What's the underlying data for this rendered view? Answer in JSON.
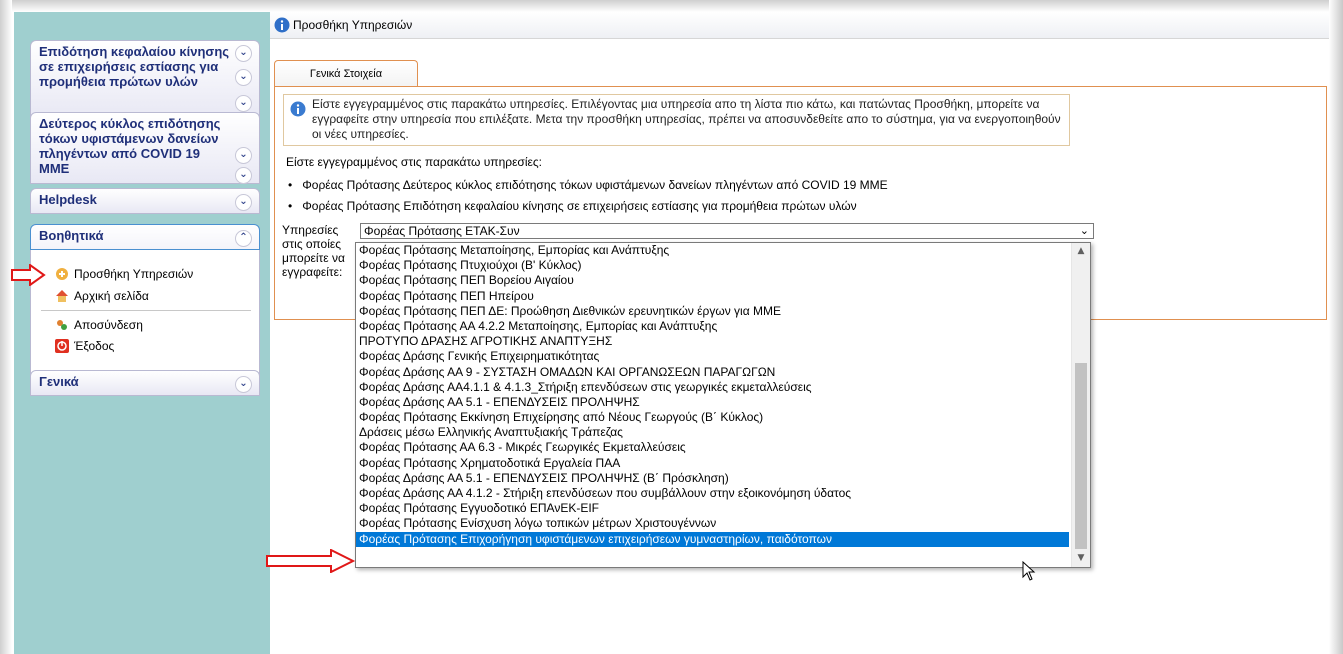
{
  "sidebar": {
    "panels": [
      {
        "title": "Επιδότηση κεφαλαίου κίνησης σε επιχειρήσεις εστίασης για προμήθεια πρώτων υλών"
      },
      {
        "title": "Δεύτερος κύκλος επιδότησης τόκων υφιστάμενων δανείων πληγέντων από COVID 19 ΜΜΕ"
      },
      {
        "title": "Helpdesk"
      },
      {
        "title": "Βοηθητικά"
      },
      {
        "title": "Γενικά"
      }
    ],
    "items": [
      {
        "label": "Προσθήκη Υπηρεσιών",
        "icon": "add-service-icon"
      },
      {
        "label": "Αρχική σελίδα",
        "icon": "home-icon"
      },
      {
        "label": "Αποσύνδεση",
        "icon": "logout-icon"
      },
      {
        "label": "Έξοδος",
        "icon": "exit-icon"
      }
    ]
  },
  "main": {
    "title": "Προσθήκη Υπηρεσιών",
    "tab": "Γενικά Στοιχεία",
    "notice": "Είστε εγγεγραμμένος στις παρακάτω υπηρεσίες. Επιλέγοντας μια υπηρεσία απο τη λίστα πιο κάτω, και πατώντας Προσθήκη, μπορείτε να εγγραφείτε στην υπηρεσία που επιλέξατε. Μετα την προσθήκη υπηρεσίας, πρέπει να αποσυνδεθείτε απο το σύστημα, για να ενεργοποιηθούν οι νέες υπηρεσίες.",
    "registered_title": "Είστε εγγεγραμμένος στις παρακάτω υπηρεσίες:",
    "registered": [
      "Φορέας Πρότασης Δεύτερος κύκλος επιδότησης τόκων υφιστάμενων δανείων πληγέντων από COVID 19 ΜΜΕ",
      "Φορέας Πρότασης Επιδότηση κεφαλαίου κίνησης σε επιχειρήσεις εστίασης για προμήθεια πρώτων υλών"
    ],
    "select_label": "Υπηρεσίες στις οποίες μπορείτε να εγγραφείτε:",
    "select_value": "Φορέας Πρότασης ΕΤΑΚ-Συν",
    "options": [
      "Φορέας Πρότασης Μεταποίησης, Εμπορίας και Ανάπτυξης",
      "Φορέας Πρότασης Πτυχιούχοι (Β' Κύκλος)",
      "Φορέας Πρότασης ΠΕΠ Βορείου Αιγαίου",
      "Φορέας Πρότασης ΠΕΠ Ηπείρου",
      "Φορέας Πρότασης ΠΕΠ ΔΕ: Προώθηση Διεθνικών ερευνητικών έργων για ΜΜΕ",
      "Φορέας Πρότασης ΑΑ 4.2.2 Μεταποίησης, Εμπορίας και Ανάπτυξης",
      "ΠΡΟΤΥΠΟ ΔΡΑΣΗΣ ΑΓΡΟΤΙΚΗΣ ΑΝΑΠΤΥΞΗΣ",
      "Φορέας Δράσης Γενικής Επιχειρηματικότητας",
      "Φορέας Δράσης ΑΑ 9 - ΣΥΣΤΑΣΗ ΟΜΑΔΩΝ ΚΑΙ ΟΡΓΑΝΩΣΕΩΝ ΠΑΡΑΓΩΓΩΝ",
      "Φορέας Δράσης ΑΑ4.1.1 & 4.1.3_Στήριξη επενδύσεων στις γεωργικές εκμεταλλεύσεις",
      "Φορέας Δράσης ΑΑ 5.1 - ΕΠΕΝΔΥΣΕΙΣ ΠΡΟΛΗΨΗΣ",
      "Φορέας Πρότασης Εκκίνηση Επιχείρησης από Νέους Γεωργούς (Β΄ Κύκλος)",
      "Δράσεις μέσω Ελληνικής Αναπτυξιακής Τράπεζας",
      "Φορέας Πρότασης ΑΑ 6.3 - Μικρές Γεωργικές Εκμεταλλεύσεις",
      "Φορέας Πρότασης Χρηματοδοτικά Εργαλεία ΠΑΑ",
      "Φορέας Δράσης ΑΑ 5.1 - ΕΠΕΝΔΥΣΕΙΣ ΠΡΟΛΗΨΗΣ (Β΄ Πρόσκληση)",
      "Φορέας Δράσης ΑΑ 4.1.2 - Στήριξη επενδύσεων που συμβάλλουν στην εξοικονόμηση ύδατος",
      "Φορέας Πρότασης Εγγυοδοτικό ΕΠΑνΕΚ-EIF",
      "Φορέας Πρότασης Ενίσχυση λόγω τοπικών μέτρων Χριστουγέννων",
      "Φορέας Πρότασης Επιχορήγηση υφιστάμενων επιχειρήσεων γυμναστηρίων, παιδότοπων"
    ],
    "selected_index": 19
  },
  "colors": {
    "sidebar_bg": "#9fcfcf",
    "panel_text": "#1f2f79",
    "tab_border": "#e09050",
    "highlight": "#0078d7",
    "arrow": "#e01818"
  }
}
